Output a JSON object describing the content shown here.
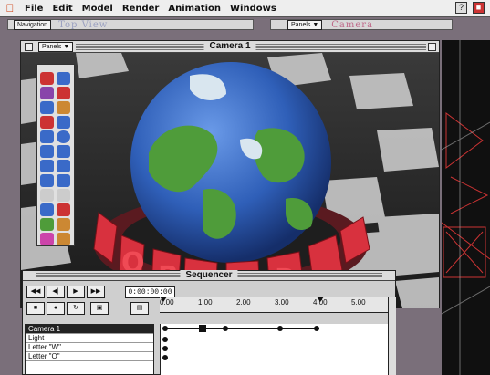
{
  "menubar": {
    "items": [
      "File",
      "Edit",
      "Model",
      "Render",
      "Animation",
      "Windows"
    ]
  },
  "navigation": {
    "nav_button": "Navigation",
    "top_view": "Top View",
    "panels_button": "Panels",
    "camera_label": "Camera"
  },
  "camera_window": {
    "panels_label": "Panels",
    "title": "Camera 1",
    "ring_letters": [
      "R",
      "L",
      "D",
      "R",
      "O"
    ]
  },
  "sequencer": {
    "title": "Sequencer",
    "timecode": "0:00:00:00",
    "ruler_ticks": [
      "0.00",
      "1.00",
      "2.00",
      "3.00",
      "4.00",
      "5.00"
    ],
    "tracks": [
      "Camera 1",
      "Light",
      "Letter \"W\"",
      "Letter \"O\""
    ],
    "controls": [
      "REW",
      "BACK",
      "PLAY",
      "FF"
    ]
  },
  "colors": {
    "globe_ocean": "#2f5fb8",
    "land": "#4f9c3a",
    "ring_red": "#d8313e"
  }
}
